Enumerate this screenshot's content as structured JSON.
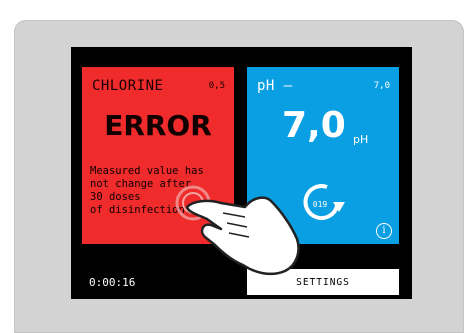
{
  "chlorine": {
    "title": "CHLORINE",
    "range": "0,5",
    "status": "ERROR",
    "message_lines": [
      "Measured value has",
      "not change after",
      "30 doses",
      "of disinfection."
    ]
  },
  "ph": {
    "title": "pH –",
    "range": "7,0",
    "value": "7,0",
    "unit": "pH",
    "cycle_count": "019"
  },
  "footer": {
    "timer": "0:00:16",
    "settings_label": "SETTINGS"
  },
  "icons": {
    "info": "info-icon",
    "cycle": "refresh-cycle-icon",
    "pointer": "hand-pointer-icon"
  },
  "colors": {
    "chlorine_panel": "#ef2b2b",
    "ph_panel": "#0a9fe3",
    "screen": "#000000"
  }
}
